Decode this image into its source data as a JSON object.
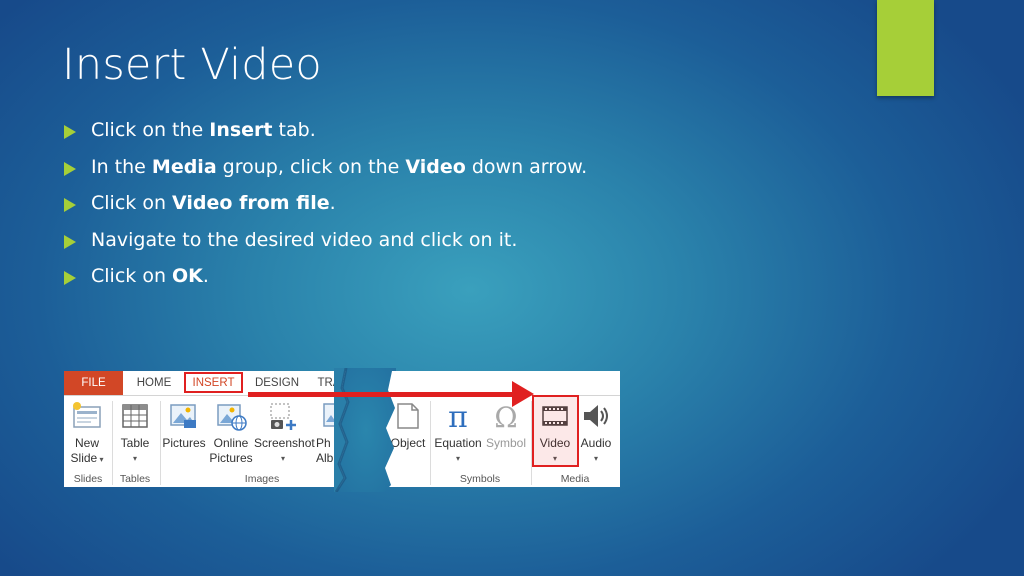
{
  "slide": {
    "title": "Insert Video",
    "bullets": [
      {
        "pre": "Click on the ",
        "bold": "Insert",
        "post": " tab."
      },
      {
        "pre": "In the ",
        "bold": "Media",
        "mid": " group, click on the ",
        "bold2": "Video",
        "post": " down arrow."
      },
      {
        "pre": "Click on ",
        "bold": "Video from file",
        "post": "."
      },
      {
        "pre": "Navigate to the desired video and click on it.",
        "bold": "",
        "post": ""
      },
      {
        "pre": "Click on ",
        "bold": "OK",
        "post": "."
      }
    ],
    "accent_color": "#a6cf38"
  },
  "ribbon": {
    "tabs": [
      "FILE",
      "HOME",
      "INSERT",
      "DESIGN",
      "TRA"
    ],
    "buttons": {
      "new_slide": [
        "New",
        "Slide"
      ],
      "table": "Table",
      "pictures": "Pictures",
      "online_pictures": [
        "Online",
        "Pictures"
      ],
      "screenshot": "Screenshot",
      "photo_album": [
        "Ph",
        "Albu"
      ],
      "object": "Object",
      "equation": "Equation",
      "symbol": "Symbol",
      "video": "Video",
      "audio": "Audio"
    },
    "groups": {
      "slides": "Slides",
      "tables": "Tables",
      "images": "Images",
      "symbols": "Symbols",
      "media": "Media"
    },
    "highlight_color": "#e02020",
    "file_tab_color": "#d24726"
  }
}
